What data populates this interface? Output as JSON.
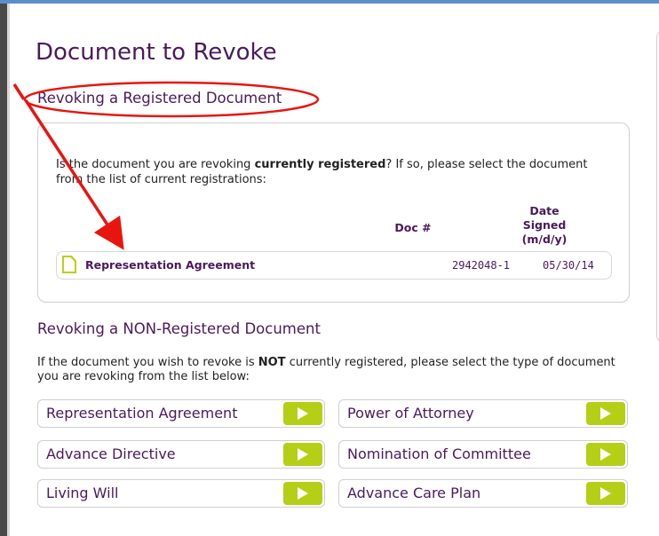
{
  "page": {
    "title": "Document to Revoke"
  },
  "registered": {
    "heading": "Revoking a Registered Document",
    "question_pre": "Is the document you are revoking ",
    "question_bold": "currently registered",
    "question_post": "? If so, please select the document from the list of current registrations:",
    "columns": {
      "doc_num": "Doc #",
      "date_line1": "Date",
      "date_line2": "Signed",
      "date_line3": "(m/d/y)"
    },
    "rows": [
      {
        "name": "Representation Agreement",
        "doc_num": "2942048-1",
        "date_signed": "05/30/14",
        "icon": "document-icon"
      }
    ]
  },
  "non_registered": {
    "heading": "Revoking a NON-Registered Document",
    "intro_pre": "If the document you wish to revoke is ",
    "intro_bold": "NOT",
    "intro_post": " currently registered, please select the type of document you are revoking from the list below:",
    "options": [
      {
        "label": "Representation Agreement",
        "icon": "play-arrow-icon"
      },
      {
        "label": "Power of Attorney",
        "icon": "play-arrow-icon"
      },
      {
        "label": "Advance Directive",
        "icon": "play-arrow-icon"
      },
      {
        "label": "Nomination of Committee",
        "icon": "play-arrow-icon"
      },
      {
        "label": "Living Will",
        "icon": "play-arrow-icon"
      },
      {
        "label": "Advance Care Plan",
        "icon": "play-arrow-icon"
      }
    ]
  },
  "colors": {
    "heading_purple": "#4a1a5c",
    "go_button_green": "#b4cf16",
    "annotation_red": "#e8150f",
    "top_border_blue": "#5b8fc9"
  }
}
